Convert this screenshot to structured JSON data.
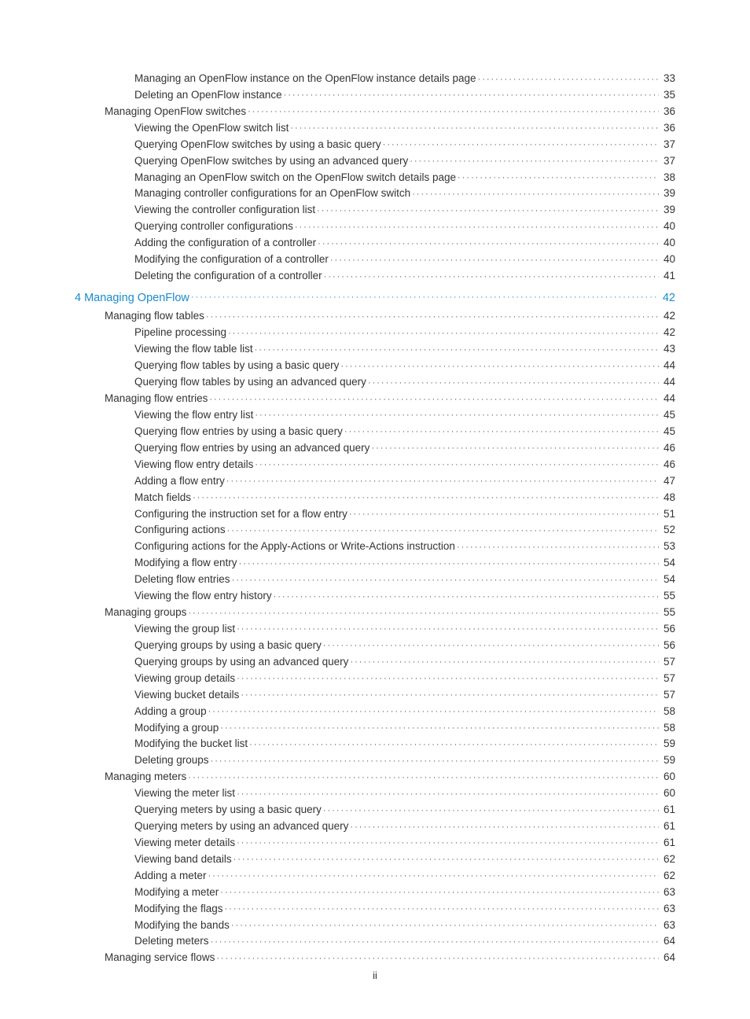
{
  "toc": [
    {
      "level": 3,
      "title": "Managing an OpenFlow instance on the OpenFlow instance details page",
      "page": "33"
    },
    {
      "level": 3,
      "title": "Deleting an OpenFlow instance",
      "page": "35"
    },
    {
      "level": 2,
      "title": "Managing OpenFlow switches",
      "page": "36"
    },
    {
      "level": 3,
      "title": "Viewing the OpenFlow switch list",
      "page": "36"
    },
    {
      "level": 3,
      "title": "Querying OpenFlow switches by using a basic query",
      "page": "37"
    },
    {
      "level": 3,
      "title": "Querying OpenFlow switches by using an advanced query",
      "page": "37"
    },
    {
      "level": 3,
      "title": "Managing an OpenFlow switch on the OpenFlow switch details page",
      "page": "38"
    },
    {
      "level": 3,
      "title": "Managing controller configurations for an OpenFlow switch",
      "page": "39"
    },
    {
      "level": 3,
      "title": "Viewing the controller configuration list",
      "page": "39"
    },
    {
      "level": 3,
      "title": "Querying controller configurations",
      "page": "40"
    },
    {
      "level": 3,
      "title": "Adding the configuration of a controller",
      "page": "40"
    },
    {
      "level": 3,
      "title": "Modifying the configuration of a controller",
      "page": "40"
    },
    {
      "level": 3,
      "title": "Deleting the configuration of a controller",
      "page": "41"
    },
    {
      "level": 1,
      "chapter": true,
      "title": "4 Managing OpenFlow",
      "page": "42"
    },
    {
      "level": 2,
      "title": "Managing flow tables",
      "page": "42"
    },
    {
      "level": 3,
      "title": "Pipeline processing",
      "page": "42"
    },
    {
      "level": 3,
      "title": "Viewing the flow table list",
      "page": "43"
    },
    {
      "level": 3,
      "title": "Querying flow tables by using a basic query",
      "page": "44"
    },
    {
      "level": 3,
      "title": "Querying flow tables by using an advanced query",
      "page": "44"
    },
    {
      "level": 2,
      "title": "Managing flow entries",
      "page": "44"
    },
    {
      "level": 3,
      "title": "Viewing the flow entry list",
      "page": "45"
    },
    {
      "level": 3,
      "title": "Querying flow entries by using a basic query",
      "page": "45"
    },
    {
      "level": 3,
      "title": "Querying flow entries by using an advanced query",
      "page": "46"
    },
    {
      "level": 3,
      "title": "Viewing flow entry details",
      "page": "46"
    },
    {
      "level": 3,
      "title": "Adding a flow entry",
      "page": "47"
    },
    {
      "level": 3,
      "title": "Match fields",
      "page": "48"
    },
    {
      "level": 3,
      "title": "Configuring the instruction set for a flow entry",
      "page": "51"
    },
    {
      "level": 3,
      "title": "Configuring actions",
      "page": "52"
    },
    {
      "level": 3,
      "title": "Configuring actions for the Apply-Actions or Write-Actions instruction",
      "page": "53"
    },
    {
      "level": 3,
      "title": "Modifying a flow entry",
      "page": "54"
    },
    {
      "level": 3,
      "title": "Deleting flow entries",
      "page": "54"
    },
    {
      "level": 3,
      "title": "Viewing the flow entry history",
      "page": "55"
    },
    {
      "level": 2,
      "title": "Managing groups",
      "page": "55"
    },
    {
      "level": 3,
      "title": "Viewing the group list",
      "page": "56"
    },
    {
      "level": 3,
      "title": "Querying groups by using a basic query",
      "page": "56"
    },
    {
      "level": 3,
      "title": "Querying groups by using an advanced query",
      "page": "57"
    },
    {
      "level": 3,
      "title": "Viewing group details",
      "page": "57"
    },
    {
      "level": 3,
      "title": "Viewing bucket details",
      "page": "57"
    },
    {
      "level": 3,
      "title": "Adding a group",
      "page": "58"
    },
    {
      "level": 3,
      "title": "Modifying a group",
      "page": "58"
    },
    {
      "level": 3,
      "title": "Modifying the bucket list",
      "page": "59"
    },
    {
      "level": 3,
      "title": "Deleting groups",
      "page": "59"
    },
    {
      "level": 2,
      "title": "Managing meters",
      "page": "60"
    },
    {
      "level": 3,
      "title": "Viewing the meter list",
      "page": "60"
    },
    {
      "level": 3,
      "title": "Querying meters by using a basic query",
      "page": "61"
    },
    {
      "level": 3,
      "title": "Querying meters by using an advanced query",
      "page": "61"
    },
    {
      "level": 3,
      "title": "Viewing meter details",
      "page": "61"
    },
    {
      "level": 3,
      "title": "Viewing band details",
      "page": "62"
    },
    {
      "level": 3,
      "title": "Adding a meter",
      "page": "62"
    },
    {
      "level": 3,
      "title": "Modifying a meter",
      "page": "63"
    },
    {
      "level": 3,
      "title": "Modifying the flags",
      "page": "63"
    },
    {
      "level": 3,
      "title": "Modifying the bands",
      "page": "63"
    },
    {
      "level": 3,
      "title": "Deleting meters",
      "page": "64"
    },
    {
      "level": 2,
      "title": "Managing service flows",
      "page": "64"
    }
  ],
  "footer": "ii"
}
